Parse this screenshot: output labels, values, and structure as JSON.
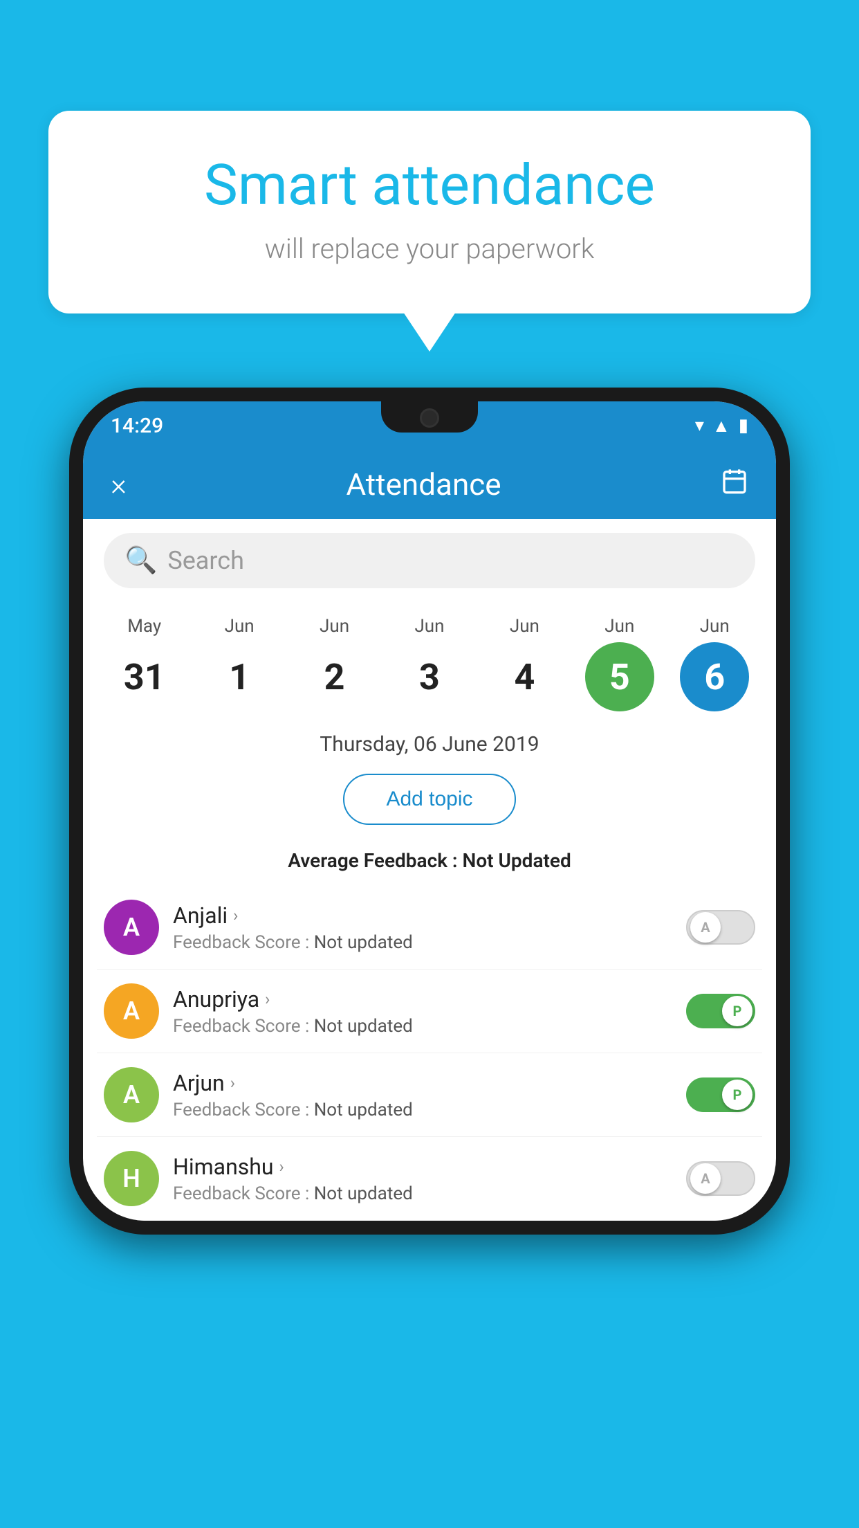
{
  "background": {
    "color": "#1ab8e8"
  },
  "speech_bubble": {
    "title": "Smart attendance",
    "subtitle": "will replace your paperwork"
  },
  "phone": {
    "status_bar": {
      "time": "14:29",
      "icons": [
        "wifi",
        "signal",
        "battery"
      ]
    },
    "header": {
      "close_label": "×",
      "title": "Attendance",
      "calendar_icon": "📅"
    },
    "search": {
      "placeholder": "Search"
    },
    "calendar": {
      "days": [
        {
          "month": "May",
          "date": "31",
          "state": "normal"
        },
        {
          "month": "Jun",
          "date": "1",
          "state": "normal"
        },
        {
          "month": "Jun",
          "date": "2",
          "state": "normal"
        },
        {
          "month": "Jun",
          "date": "3",
          "state": "normal"
        },
        {
          "month": "Jun",
          "date": "4",
          "state": "normal"
        },
        {
          "month": "Jun",
          "date": "5",
          "state": "today"
        },
        {
          "month": "Jun",
          "date": "6",
          "state": "selected"
        }
      ]
    },
    "selected_date_label": "Thursday, 06 June 2019",
    "add_topic_label": "Add topic",
    "avg_feedback_label": "Average Feedback :",
    "avg_feedback_value": "Not Updated",
    "students": [
      {
        "name": "Anjali",
        "initial": "A",
        "avatar_color": "#9c27b0",
        "feedback_label": "Feedback Score :",
        "feedback_value": "Not updated",
        "toggle_state": "off",
        "toggle_knob_label": "A"
      },
      {
        "name": "Anupriya",
        "initial": "A",
        "avatar_color": "#f5a623",
        "feedback_label": "Feedback Score :",
        "feedback_value": "Not updated",
        "toggle_state": "on",
        "toggle_knob_label": "P"
      },
      {
        "name": "Arjun",
        "initial": "A",
        "avatar_color": "#8bc34a",
        "feedback_label": "Feedback Score :",
        "feedback_value": "Not updated",
        "toggle_state": "on",
        "toggle_knob_label": "P"
      },
      {
        "name": "Himanshu",
        "initial": "H",
        "avatar_color": "#8bc34a",
        "feedback_label": "Feedback Score :",
        "feedback_value": "Not updated",
        "toggle_state": "off",
        "toggle_knob_label": "A"
      }
    ]
  }
}
